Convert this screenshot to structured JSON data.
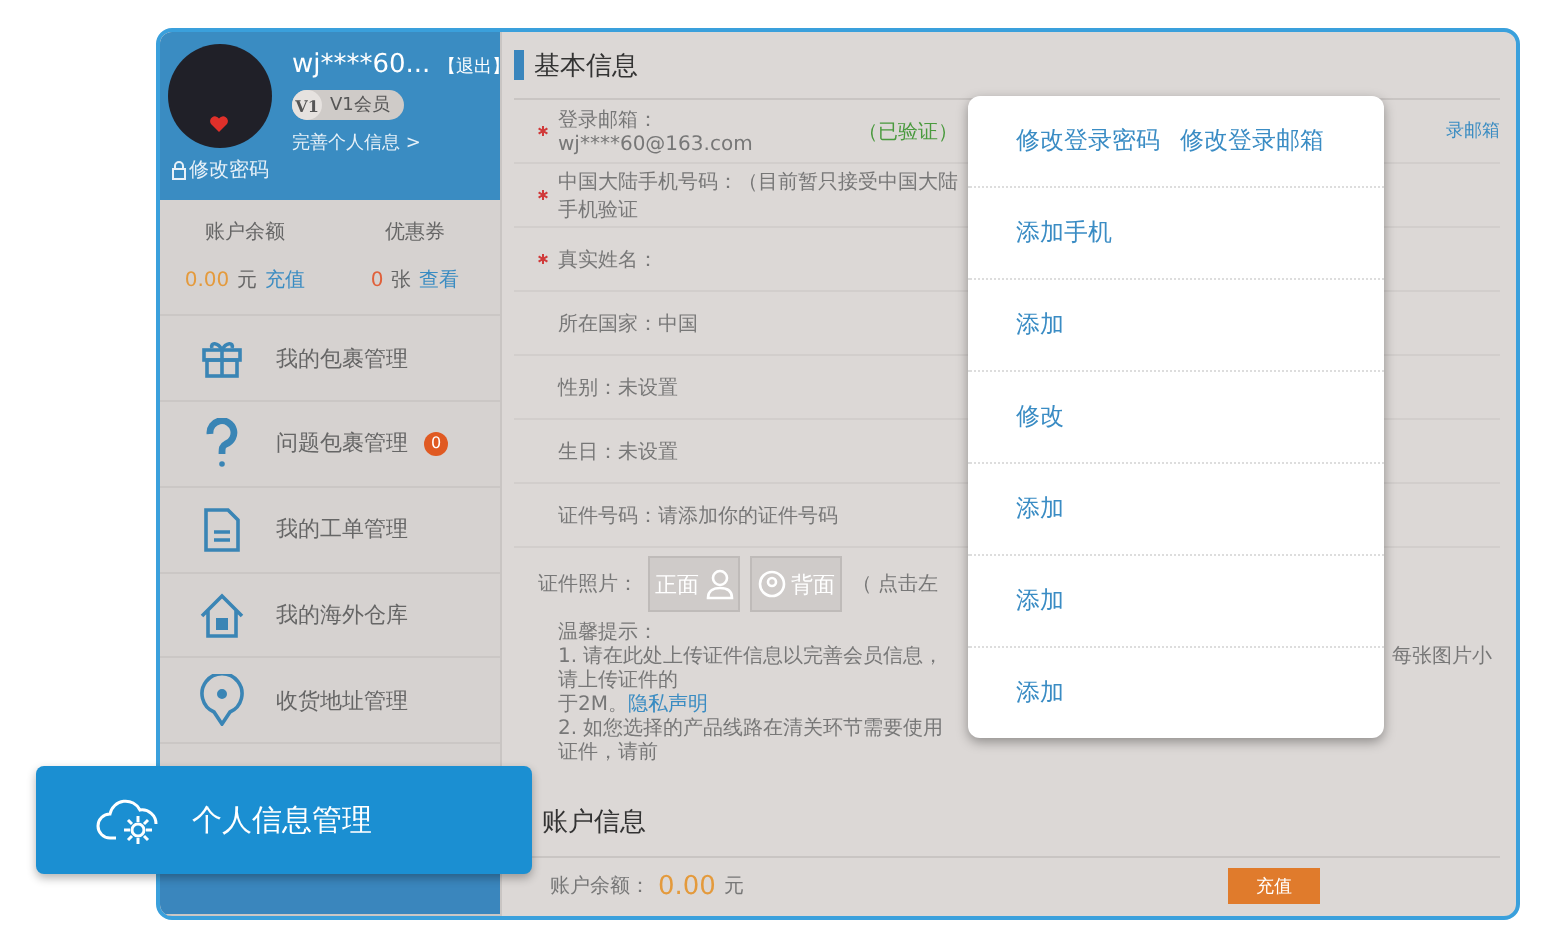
{
  "user": {
    "name": "wj****60...",
    "logout": "【退出】",
    "badge": "V1",
    "level": "V1会员",
    "complete_profile": "完善个人信息 >",
    "change_password": "修改密码"
  },
  "wallet": [
    {
      "label": "账户余额",
      "amount": "0.00",
      "unit": "元",
      "action": "充值"
    },
    {
      "label": "优惠券",
      "amount": "0",
      "unit": "张",
      "action": "查看"
    }
  ],
  "menu": [
    {
      "label": "我的包裹管理",
      "selected": false
    },
    {
      "label": "问题包裹管理",
      "badge": "0",
      "selected": false
    },
    {
      "label": "我的工单管理",
      "selected": false
    },
    {
      "label": "我的海外仓库",
      "selected": false
    },
    {
      "label": "收货地址管理",
      "selected": false
    },
    {
      "selected": true
    }
  ],
  "basic_info": {
    "title": "基本信息",
    "rows": [
      {
        "required": true,
        "label": "登录邮箱：wj****60@163.com",
        "status": "（已验证）",
        "right": "录邮箱"
      },
      {
        "required": true,
        "label": "中国大陆手机号码：（目前暂只接受中国大陆手机验证"
      },
      {
        "required": true,
        "label": "真实姓名："
      },
      {
        "required": false,
        "label": "所在国家：中国"
      },
      {
        "required": false,
        "label": "性别：未设置"
      },
      {
        "required": false,
        "label": "生日：未设置"
      },
      {
        "required": false,
        "label": "证件号码：请添加你的证件号码"
      }
    ],
    "photo": {
      "label": "证件照片：",
      "front": "正面",
      "back": "背面",
      "note": "（ 点击左"
    },
    "tips": {
      "title": "温馨提示：",
      "line1": "1. 请在此处上传证件信息以完善会员信息，请上传证件的",
      "line1_right": "每张图片小",
      "line1b": "于2M。",
      "privacy": "隐私声明",
      "line2": "2. 如您选择的产品线路在清关环节需要使用证件，请前"
    }
  },
  "account": {
    "title": "账户信息",
    "label": "账户余额：",
    "amount": "0.00",
    "unit": "元",
    "button": "充值"
  },
  "popup": {
    "rows": [
      {
        "links": [
          "修改登录密码",
          "修改登录邮箱"
        ]
      },
      {
        "links": [
          "添加手机"
        ]
      },
      {
        "links": [
          "添加"
        ]
      },
      {
        "links": [
          "修改"
        ]
      },
      {
        "links": [
          "添加"
        ]
      },
      {
        "links": [
          "添加"
        ]
      },
      {
        "links": [
          "添加"
        ]
      }
    ]
  },
  "callout": {
    "label": "个人信息管理"
  }
}
